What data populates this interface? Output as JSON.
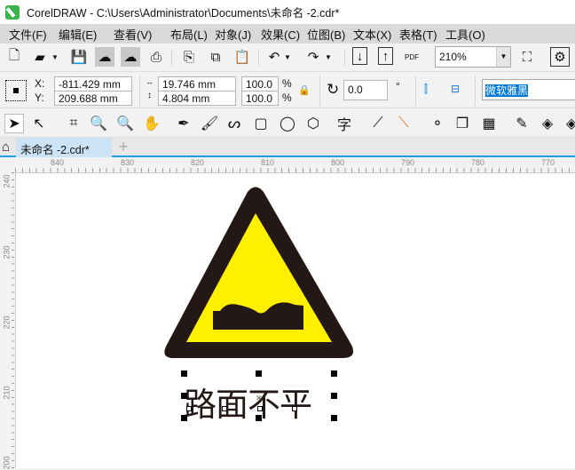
{
  "window": {
    "title": "CorelDRAW - C:\\Users\\Administrator\\Documents\\未命名 -2.cdr*"
  },
  "menu": [
    "文件(F)",
    "编辑(E)",
    "查看(V)",
    "布局(L)",
    "对象(J)",
    "效果(C)",
    "位图(B)",
    "文本(X)",
    "表格(T)",
    "工具(O)"
  ],
  "toolbar": {
    "zoom": "210%",
    "pdf_label": "PDF"
  },
  "props": {
    "x_label": "X:",
    "y_label": "Y:",
    "x": "-811.429 mm",
    "y": "209.688 mm",
    "width": "19.746 mm",
    "height": "4.804 mm",
    "scale_x": "100.0",
    "scale_y": "100.0",
    "pct": "%",
    "rotation": "0.0",
    "degree": "°",
    "font": "微软雅黑"
  },
  "tabs": {
    "document": "未命名 -2.cdr*",
    "add": "+"
  },
  "ruler": {
    "h": [
      "840",
      "830",
      "820",
      "810",
      "800",
      "790",
      "780",
      "770"
    ],
    "v": [
      "240",
      "230",
      "220",
      "210",
      "200"
    ]
  },
  "canvas": {
    "text": "路面不平",
    "sign_colors": {
      "border": "#231815",
      "fill": "#fff000"
    }
  }
}
